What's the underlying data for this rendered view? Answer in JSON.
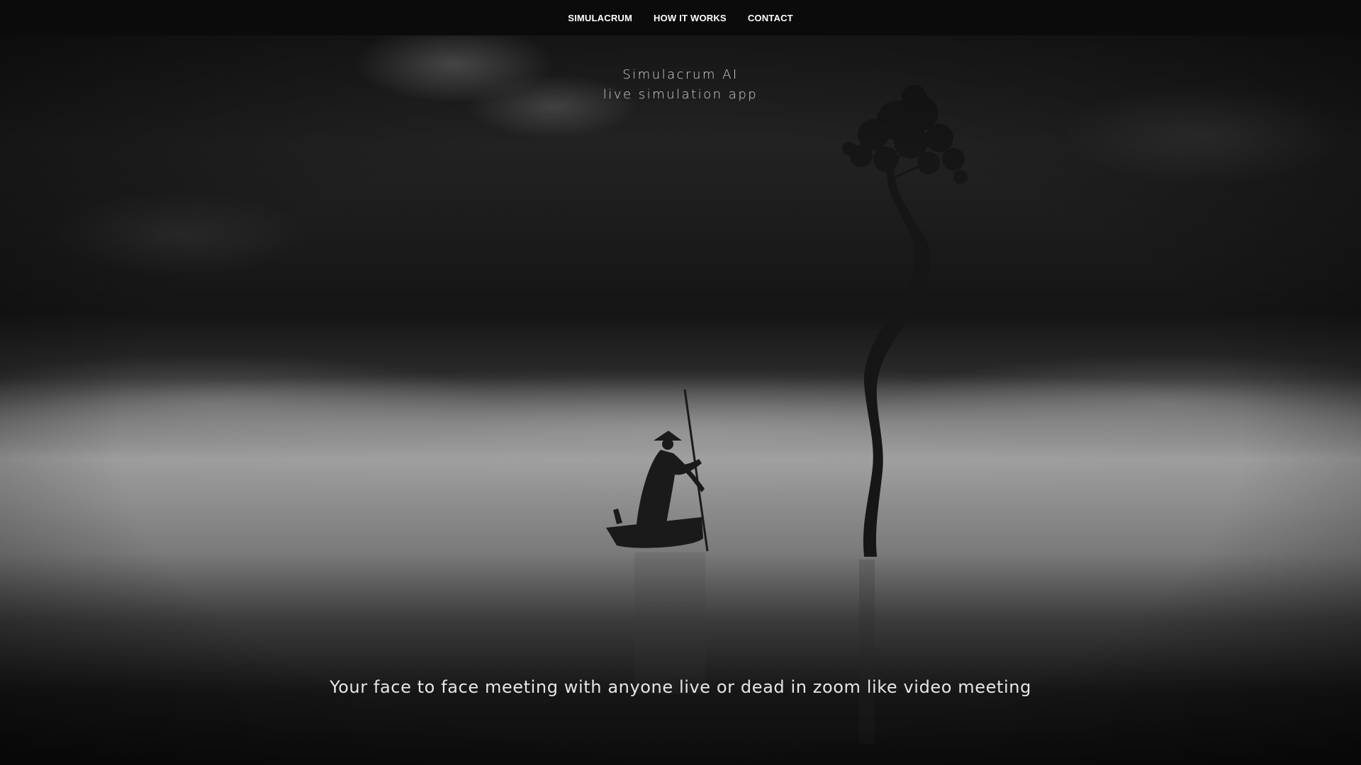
{
  "nav": {
    "items": [
      {
        "label": "SIMULACRUM"
      },
      {
        "label": "HOW IT WORKS"
      },
      {
        "label": "CONTACT"
      }
    ]
  },
  "hero": {
    "brand_line1": "Simulacrum AI",
    "brand_line2": "live simulation app",
    "tagline": "Your face to face meeting with anyone live or dead in zoom like video meeting"
  },
  "colors": {
    "navbar_bg": "#0b0b0b",
    "nav_text": "#ffffff",
    "hero_text": "#d6d6d6"
  },
  "icons": [
    "boat-silhouette",
    "tree-silhouette"
  ]
}
